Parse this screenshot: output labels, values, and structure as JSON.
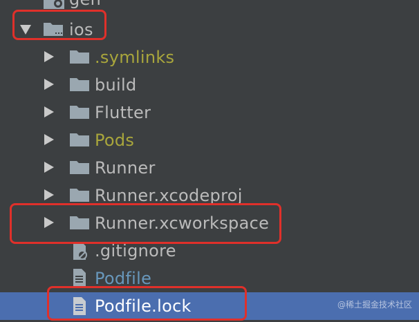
{
  "tree": {
    "items": [
      {
        "label": "gen",
        "kind": "module",
        "color": "#bbbbbb"
      },
      {
        "label": "ios",
        "kind": "folder",
        "expanded": true,
        "color": "#bbbbbb"
      },
      {
        "label": ".symlinks",
        "kind": "folder",
        "color": "#a9a63c"
      },
      {
        "label": "build",
        "kind": "folder",
        "color": "#bbbbbb"
      },
      {
        "label": "Flutter",
        "kind": "folder",
        "color": "#bbbbbb"
      },
      {
        "label": "Pods",
        "kind": "folder",
        "color": "#a9a63c"
      },
      {
        "label": "Runner",
        "kind": "folder",
        "color": "#bbbbbb"
      },
      {
        "label": "Runner.xcodeproj",
        "kind": "folder",
        "color": "#bbbbbb"
      },
      {
        "label": "Runner.xcworkspace",
        "kind": "folder",
        "color": "#bbbbbb"
      },
      {
        "label": ".gitignore",
        "kind": "ignored-file",
        "color": "#bbbbbb"
      },
      {
        "label": "Podfile",
        "kind": "file",
        "color": "#6897bb"
      },
      {
        "label": "Podfile.lock",
        "kind": "file",
        "selected": true,
        "color": "#ffffff"
      }
    ]
  },
  "watermark": "@稀土掘金技术社区",
  "colors": {
    "background": "#3c3f41",
    "selection": "#4b6eaf",
    "highlight_box": "#e0302a",
    "folder_icon": "#9aa7b0"
  }
}
